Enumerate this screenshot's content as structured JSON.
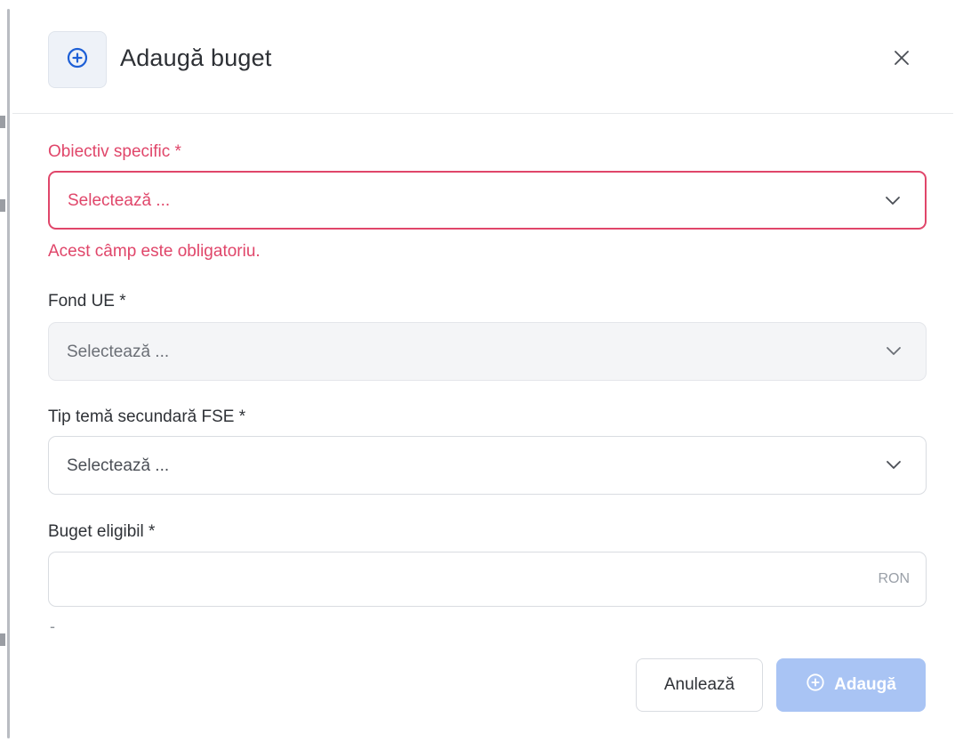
{
  "modal": {
    "title": "Adaugă buget",
    "header_icon": "plus-circle-icon",
    "close_icon": "close-icon"
  },
  "fields": [
    {
      "label": "Obiectiv specific *",
      "placeholder": "Selectează ...",
      "state": "error",
      "error_message": "Acest câmp este obligatoriu."
    },
    {
      "label": "Fond UE *",
      "placeholder": "Selectează ...",
      "state": "disabled"
    },
    {
      "label": "Tip temă secundară FSE *",
      "placeholder": "Selectează ...",
      "state": "default"
    }
  ],
  "budget": {
    "label": "Buget eligibil *",
    "value": "",
    "unit": "RON",
    "helper": "-"
  },
  "actions": {
    "cancel_label": "Anulează",
    "add_label": "Adaugă",
    "add_icon": "plus-circle-icon",
    "add_disabled": true
  },
  "colors": {
    "error": "#e0466a",
    "primary": "#1d5fd6",
    "primary_disabled": "#a9c4f4",
    "border": "#d9dce1"
  }
}
